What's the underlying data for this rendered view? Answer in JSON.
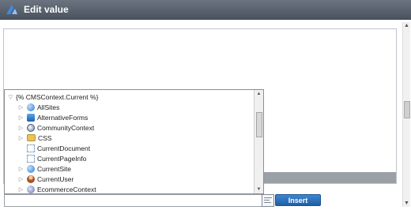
{
  "window": {
    "title": "Edit value",
    "logo_icon": "kentico-logo-icon"
  },
  "tree": {
    "root": {
      "label": "{% CMSContext.Current %}",
      "icon": "collapse-arrow-icon"
    },
    "items": [
      {
        "label": "AllSites",
        "icon": "globe-icon",
        "expandable": true
      },
      {
        "label": "AlternativeForms",
        "icon": "cube-icon",
        "expandable": true
      },
      {
        "label": "CommunityContext",
        "icon": "community-icon",
        "expandable": true
      },
      {
        "label": "CSS",
        "icon": "folder-icon",
        "expandable": true
      },
      {
        "label": "CurrentDocument",
        "icon": "property-icon",
        "expandable": false
      },
      {
        "label": "CurrentPageInfo",
        "icon": "property-icon",
        "expandable": false
      },
      {
        "label": "CurrentSite",
        "icon": "globe-icon",
        "expandable": true
      },
      {
        "label": "CurrentUser",
        "icon": "user-icon",
        "expandable": true
      },
      {
        "label": "EcommerceContext",
        "icon": "ecommerce-icon",
        "expandable": true
      }
    ]
  },
  "toolbar": {
    "insert_label": "Insert",
    "macro_icon": "macro-editor-icon"
  },
  "colors": {
    "accent": "#2a6fbf",
    "titlebar": "#555e69"
  }
}
